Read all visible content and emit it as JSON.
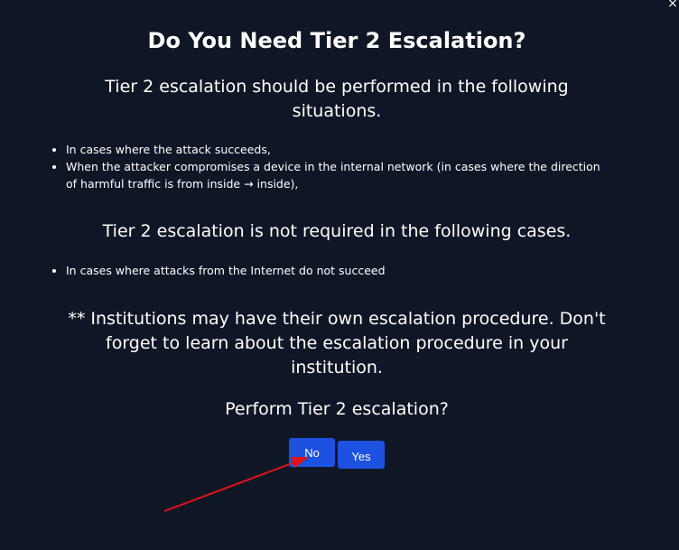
{
  "dialog": {
    "close_label": "×",
    "title": "Do You Need Tier 2 Escalation?",
    "escalation_intro": "Tier 2 escalation should be performed in the following situations.",
    "escalation_cases": [
      "In cases where the attack succeeds,",
      "When the attacker compromises a device in the internal network (in cases where the direction of harmful traffic is from inside → inside),"
    ],
    "no_escalation_intro": "Tier 2 escalation is not required in the following cases.",
    "no_escalation_cases": [
      "In cases where attacks from the Internet do not succeed"
    ],
    "note": "** Institutions may have their own escalation procedure. Don't forget to learn about the escalation procedure in your institution.",
    "question": "Perform Tier 2 escalation?",
    "buttons": {
      "no_label": "No",
      "yes_label": "Yes"
    }
  },
  "colors": {
    "background": "#0f1726",
    "button": "#1d52e0",
    "annotation_arrow": "#e01414"
  }
}
